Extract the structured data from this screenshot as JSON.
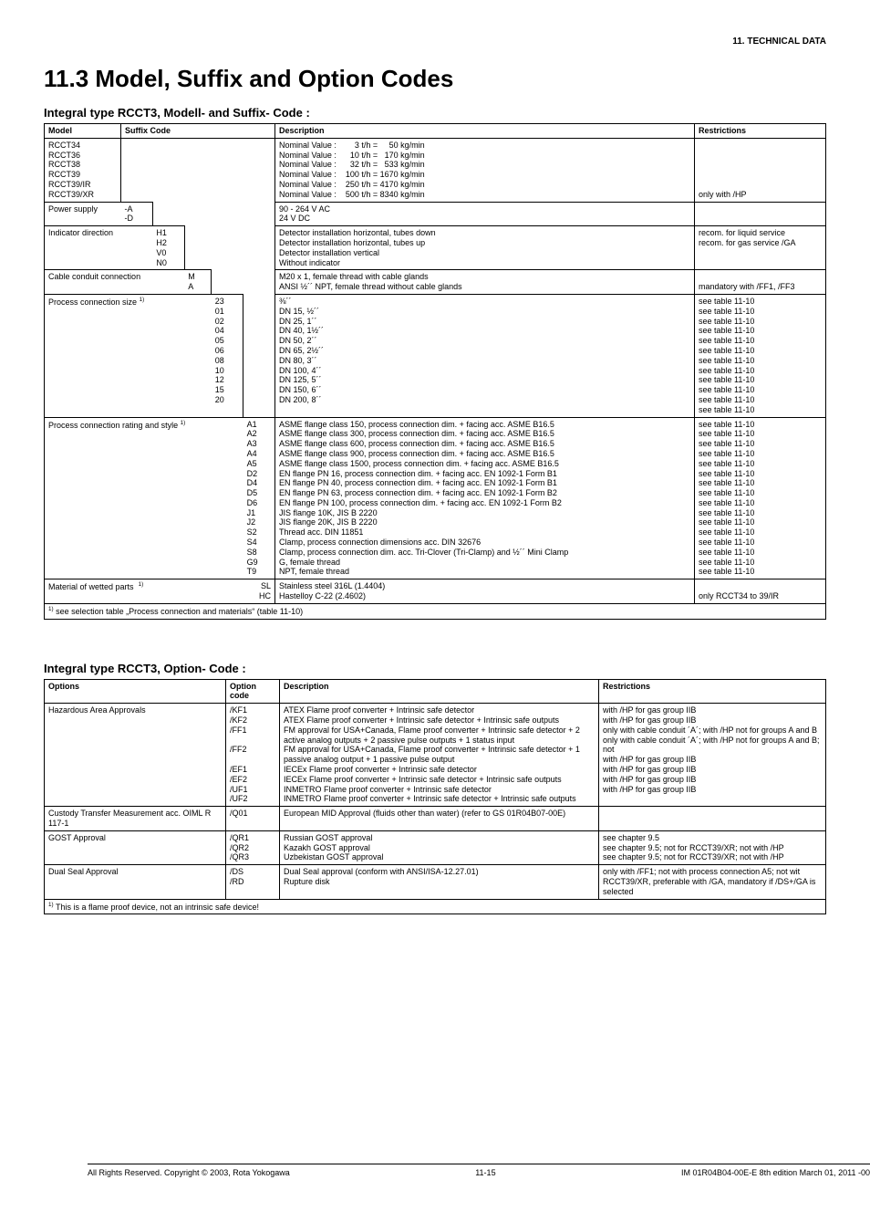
{
  "header": {
    "section_label": "11.   TECHNICAL DATA",
    "title": "11.3  Model, Suffix and Option Codes"
  },
  "table1_title": "Integral type RCCT3, Modell- and Suffix- Code :",
  "t1_headers": {
    "model": "Model",
    "suffix": "Suffix Code",
    "desc": "Description",
    "restr": "Restrictions"
  },
  "t1_row_model": {
    "models": "RCCT34\nRCCT36\nRCCT38\nRCCT39\nRCCT39/IR\nRCCT39/XR",
    "desc": "Nominal Value :        3 t/h =     50 kg/min\nNominal Value :      10 t/h =   170 kg/min\nNominal Value :      32 t/h =   533 kg/min\nNominal Value :    100 t/h = 1670 kg/min\nNominal Value :    250 t/h = 4170 kg/min\nNominal Value :    500 t/h = 8340 kg/min",
    "restr": "only with /HP"
  },
  "t1_power": {
    "label": "Power supply",
    "codes": "-A\n-D",
    "desc": "90 - 264 V AC\n24 V DC"
  },
  "t1_indicator": {
    "label": "Indicator direction",
    "codes": "H1\nH2\nV0\nN0",
    "desc": "Detector installation horizontal, tubes down\nDetector installation horizontal, tubes up\nDetector installation vertical\nWithout indicator",
    "restr": "recom. for liquid service\nrecom. for gas service /GA"
  },
  "t1_cable": {
    "label": "Cable conduit connection",
    "codes": "M\nA",
    "desc": "M20 x 1, female thread with cable glands\nANSI ½´´ NPT, female thread without cable glands",
    "restr": "mandatory with /FF1, /FF3"
  },
  "t1_procsize": {
    "label": "Process connection size",
    "codes": "23\n01\n02\n04\n05\n06\n08\n10\n12\n15\n20",
    "desc": "⅜´´\nDN 15, ½´´\nDN 25, 1´´\nDN 40, 1½´´\nDN 50, 2´´\nDN 65, 2½´´\nDN 80, 3´´\nDN 100, 4´´\nDN 125, 5´´\nDN 150, 6´´\nDN 200, 8´´",
    "restr": "see table 11-10\nsee table 11-10\nsee table 11-10\nsee table 11-10\nsee table 11-10\nsee table 11-10\nsee table 11-10\nsee table 11-10\nsee table 11-10\nsee table 11-10\nsee table 11-10\nsee table 11-10"
  },
  "t1_procrating": {
    "label": "Process connection rating and style",
    "codes": "A1\nA2\nA3\nA4\nA5\nD2\nD4\nD5\nD6\nJ1\nJ2\nS2\nS4\nS8\nG9\nT9",
    "desc": "ASME flange class 150, process connection dim. + facing acc. ASME B16.5\nASME flange class 300, process connection dim. + facing acc. ASME B16.5\nASME flange class 600, process connection dim. + facing acc. ASME B16.5\nASME flange class 900, process connection dim. + facing acc. ASME B16.5\nASME flange class 1500, process connection dim. + facing acc. ASME B16.5\nEN flange PN 16, process connection dim. + facing acc. EN 1092-1 Form B1\nEN flange PN 40, process connection dim. + facing acc. EN 1092-1 Form B1\nEN flange PN 63, process connection dim. + facing acc. EN 1092-1 Form B2\nEN flange PN 100, process connection dim. + facing acc. EN 1092-1 Form B2\nJIS flange 10K, JIS B 2220\nJIS flange 20K, JIS B 2220\nThread acc. DIN 11851\nClamp, process connection dimensions acc. DIN 32676\nClamp, process connection dim. acc. Tri-Clover (Tri-Clamp) and ½´´ Mini Clamp\nG, female thread\nNPT, female thread",
    "restr": "see table 11-10\nsee table 11-10\nsee table 11-10\nsee table 11-10\nsee table 11-10\nsee table 11-10\nsee table 11-10\nsee table 11-10\nsee table 11-10\nsee table 11-10\nsee table 11-10\nsee table 11-10\nsee table 11-10\nsee table 11-10\nsee table 11-10\nsee table 11-10"
  },
  "t1_material": {
    "label": "Material of wetted parts",
    "codes": "SL\nHC",
    "desc": "Stainless steel 316L (1.4404)\nHastelloy C-22 (2.4602)",
    "restr": "only RCCT34 to 39/IR"
  },
  "t1_footnote": "see selection table „Process connection and materials“ (table 11-10)",
  "table2_title": "Integral type RCCT3, Option- Code :",
  "t2_headers": {
    "opt": "Options",
    "code": "Option code",
    "desc": "Description",
    "restr": "Restrictions"
  },
  "t2_haz": {
    "label": "Hazardous Area Approvals",
    "codes": "/KF1\n/KF2\n/FF1\n\n/FF2\n\n/EF1\n/EF2\n/UF1\n/UF2",
    "desc": "ATEX Flame proof converter + Intrinsic safe detector\nATEX Flame proof converter + Intrinsic safe detector + Intrinsic safe outputs\nFM approval for USA+Canada, Flame proof converter + Intrinsic safe detector + 2 active analog outputs + 2 passive pulse outputs + 1 status input\nFM approval for USA+Canada, Flame proof converter + Intrinsic safe detector + 1 passive analog output + 1 passive pulse output\nIECEx Flame proof converter + Intrinsic safe detector\nIECEx Flame proof converter + Intrinsic safe detector + Intrinsic safe outputs\nINMETRO Flame proof converter + Intrinsic safe detector\nINMETRO Flame proof converter + Intrinsic safe detector + Intrinsic safe outputs",
    "restr": "with /HP for gas group IIB\nwith /HP for gas group IIB\nonly with cable conduit ´A´; with /HP not for groups A and B\nonly with cable conduit ´A´; with /HP not for groups A and B; not\nwith /HP for gas group IIB\nwith /HP for gas group IIB\nwith /HP for gas group IIB\nwith /HP for gas group IIB"
  },
  "t2_custody": {
    "label": "Custody Transfer Measurement acc. OIML R 117-1",
    "codes": "/Q01",
    "desc": "European MID Approval (fluids other than water) (refer to GS 01R04B07-00E)"
  },
  "t2_gost": {
    "label": "GOST Approval",
    "codes": "/QR1\n/QR2\n/QR3",
    "desc": "Russian GOST approval\nKazakh GOST approval\nUzbekistan GOST approval",
    "restr": "see chapter 9.5\nsee chapter 9.5; not for RCCT39/XR; not with /HP\nsee chapter 9.5; not for RCCT39/XR; not with /HP"
  },
  "t2_dual": {
    "label": "Dual Seal Approval",
    "codes": "/DS\n/RD",
    "desc": "Dual Seal approval (conform with ANSI/ISA-12.27.01)\nRupture disk",
    "restr": "only with /FF1; not with process connection A5; not wit RCCT39/XR, preferable with /GA, mandatory if /DS+/GA is selected"
  },
  "t2_footnote": "This is a flame proof device, not an intrinsic safe device!",
  "footer": {
    "left": "All Rights Reserved. Copyright © 2003, Rota Yokogawa",
    "center": "11-15",
    "right": "IM 01R04B04-00E-E    8th edition March 01, 2011 -00"
  }
}
